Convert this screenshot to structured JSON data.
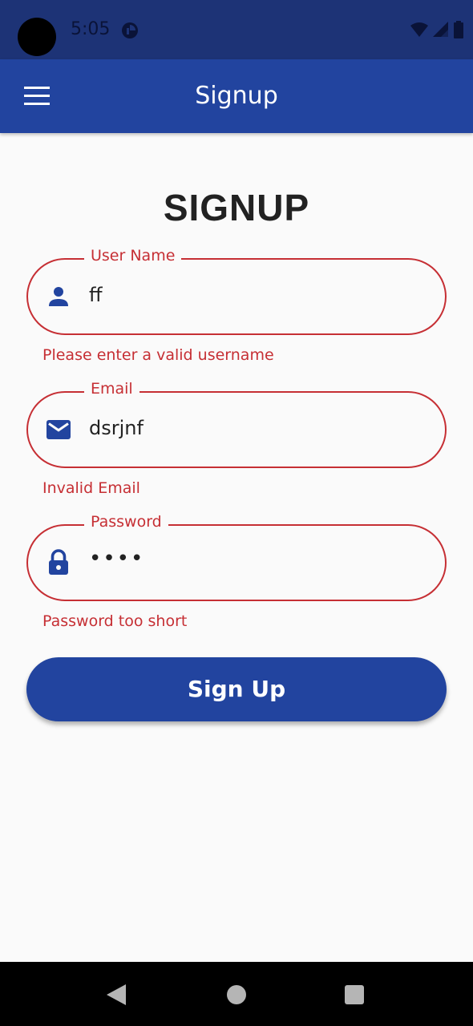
{
  "status_bar": {
    "time": "5:05",
    "icons": [
      "app-notification-icon",
      "wifi-icon",
      "signal-icon",
      "battery-icon"
    ]
  },
  "app_bar": {
    "title": "Signup",
    "menu_icon": "menu-icon",
    "color": "#22449f"
  },
  "form": {
    "heading": "SIGNUP",
    "username": {
      "label": "User Name",
      "value": "ff",
      "icon": "person-icon",
      "error": "Please enter a valid username"
    },
    "email": {
      "label": "Email",
      "value": "dsrjnf",
      "icon": "mail-icon",
      "error": "Invalid Email"
    },
    "password": {
      "label": "Password",
      "value": "••••",
      "icon": "lock-icon",
      "error": "Password too short"
    },
    "submit_label": "Sign Up"
  },
  "colors": {
    "primary": "#22449f",
    "status_bar": "#1d3376",
    "error": "#c62f34",
    "background": "#fafafa"
  },
  "nav_bar": {
    "icons": [
      "back-icon",
      "home-icon",
      "recents-icon"
    ]
  }
}
